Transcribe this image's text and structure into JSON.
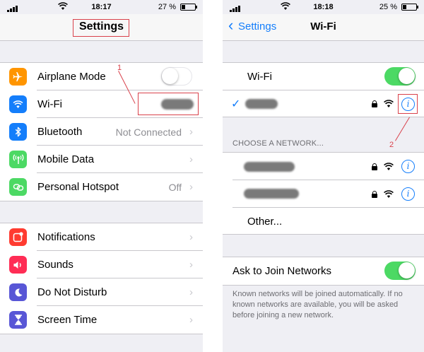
{
  "left": {
    "status": {
      "time": "18:17",
      "battery": "27 %",
      "battery_level": 0.27
    },
    "title": "Settings",
    "callout_number": "1",
    "group1": [
      {
        "label": "Airplane Mode",
        "icon": "airplane-icon",
        "color": "#ff9500",
        "toggle": "off"
      },
      {
        "label": "Wi-Fi",
        "icon": "wifi-icon",
        "color": "#147efb"
      },
      {
        "label": "Bluetooth",
        "icon": "bluetooth-icon",
        "color": "#147efb",
        "detail": "Not Connected"
      },
      {
        "label": "Mobile Data",
        "icon": "antenna-icon",
        "color": "#4cd964"
      },
      {
        "label": "Personal Hotspot",
        "icon": "hotspot-icon",
        "color": "#4cd964",
        "detail": "Off"
      }
    ],
    "group2": [
      {
        "label": "Notifications",
        "icon": "notifications-icon",
        "color": "#ff3b30"
      },
      {
        "label": "Sounds",
        "icon": "speaker-icon",
        "color": "#ff2d55"
      },
      {
        "label": "Do Not Disturb",
        "icon": "moon-icon",
        "color": "#5856d6"
      },
      {
        "label": "Screen Time",
        "icon": "hourglass-icon",
        "color": "#5856d6"
      }
    ]
  },
  "right": {
    "status": {
      "time": "18:18",
      "battery": "25 %",
      "battery_level": 0.25
    },
    "back_label": "Settings",
    "title": "Wi-Fi",
    "wifi_label": "Wi-Fi",
    "wifi_toggle": "on",
    "callout_number": "2",
    "section_header": "CHOOSE A NETWORK...",
    "other_label": "Other...",
    "ask_label": "Ask to Join Networks",
    "ask_toggle": "on",
    "footer": "Known networks will be joined automatically. If no known networks are available, you will be asked before joining a new network."
  },
  "colors": {
    "accent": "#147efb",
    "toggle_on": "#4cd964",
    "callout": "#d9414b"
  }
}
